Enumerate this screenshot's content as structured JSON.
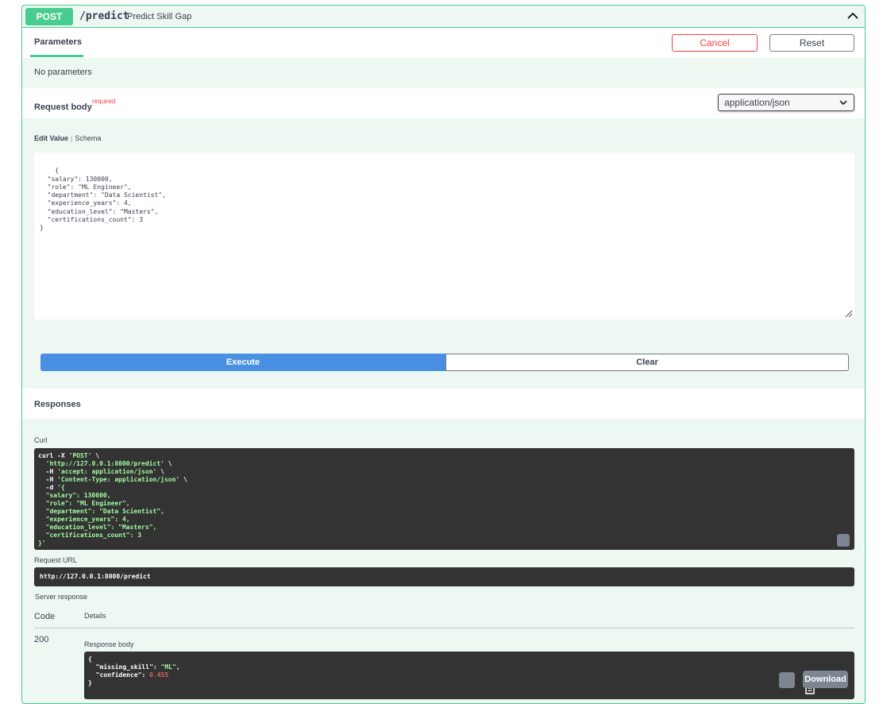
{
  "endpoint": {
    "method": "POST",
    "path": "/predict",
    "summary": "Predict Skill Gap"
  },
  "parameters": {
    "tab_label": "Parameters",
    "cancel_label": "Cancel",
    "reset_label": "Reset",
    "empty_text": "No parameters"
  },
  "request_body": {
    "label": "Request body",
    "required_label": "required",
    "content_type": "application/json",
    "edit_value_label": "Edit Value",
    "schema_label": "Schema",
    "json_text": "{\n  \"salary\": 130000,\n  \"role\": \"ML Engineer\",\n  \"department\": \"Data Scientist\",\n  \"experience_years\": 4,\n  \"education_level\": \"Masters\",\n  \"certifications_count\": 3\n}"
  },
  "actions": {
    "execute_label": "Execute",
    "clear_label": "Clear"
  },
  "responses": {
    "title": "Responses",
    "curl_label": "Curl",
    "curl": {
      "line1_cmd": "curl -X ",
      "line1_method": "'POST'",
      "line1_end": " \\",
      "line2_url": "'http://127.0.0.1:8000/predict'",
      "line2_end": " \\",
      "line3_flag": "  -H ",
      "line3_val": "'accept: application/json'",
      "line3_end": " \\",
      "line4_flag": "  -H ",
      "line4_val": "'Content-Type: application/json'",
      "line4_end": " \\",
      "line5_flag": "  -d ",
      "line5_val": "'{",
      "body_lines": [
        "  \"salary\": 130000,",
        "  \"role\": \"ML Engineer\",",
        "  \"department\": \"Data Scientist\",",
        "  \"experience_years\": 4,",
        "  \"education_level\": \"Masters\",",
        "  \"certifications_count\": 3"
      ],
      "last_line": "}'"
    },
    "request_url_label": "Request URL",
    "request_url": "http://127.0.0.1:8000/predict",
    "server_response_label": "Server response",
    "code_header": "Code",
    "details_header": "Details",
    "code": "200",
    "response_body_label": "Response body",
    "response_body": {
      "open": "{",
      "key1": "  \"missing_skill\"",
      "sep1": ": ",
      "val1": "\"ML\"",
      "end1": ",",
      "key2": "  \"confidence\"",
      "sep2": ": ",
      "val2": "0.455",
      "close": "}"
    },
    "download_label": "Download"
  },
  "colors": {
    "post": "#49cc90",
    "execute": "#4990e2",
    "cancel": "#f93e3e",
    "code_bg": "#333333"
  }
}
